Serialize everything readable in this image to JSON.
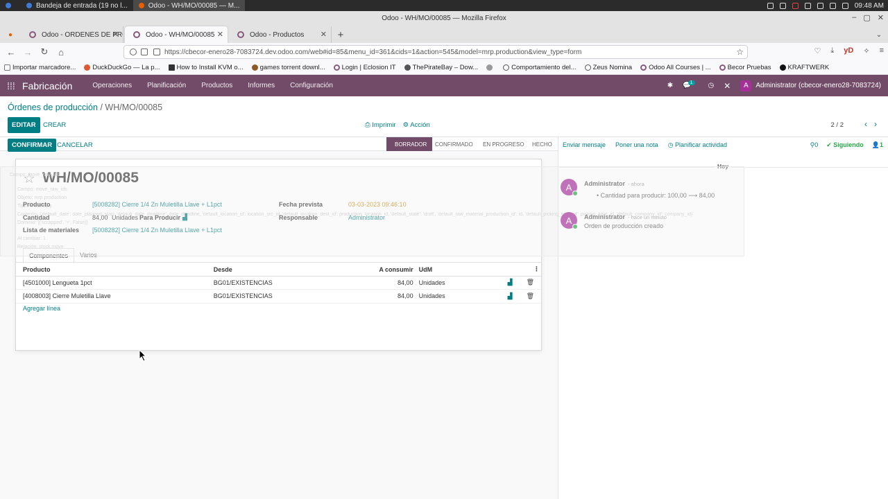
{
  "os": {
    "tasks": [
      "Bandeja de entrada (19 no l...",
      "Odoo - WH/MO/00085 — M..."
    ],
    "clock": "09:48 AM"
  },
  "window": {
    "title": "Odoo - WH/MO/00085 — Mozilla Firefox",
    "tabs": [
      "Odoo - ORDENES DE PRODUCC",
      "Odoo - WH/MO/00085",
      "Odoo - Productos"
    ],
    "url": "https://cbecor-enero28-7083724.dev.odoo.com/web#id=85&menu_id=361&cids=1&action=545&model=mrp.production&view_type=form",
    "bookmarks": [
      "Importar marcadore...",
      "DuckDuckGo — La p...",
      "How to Install KVM o...",
      "games torrent downl...",
      "Login | Eclosion IT",
      "ThePirateBay – Dow...",
      "Comportamiento del...",
      "Zeus Nomina",
      "Odoo All Courses | ...",
      "Becor Pruebas",
      "KRAFTWERK"
    ]
  },
  "odoo_nav": {
    "app": "Fabricación",
    "menus": [
      "Operaciones",
      "Planificación",
      "Productos",
      "Informes",
      "Configuración"
    ],
    "messages_count": "1",
    "user": "Administrator (cbecor-enero28-7083724)",
    "user_initial": "A"
  },
  "control": {
    "breadcrumb_parent": "Órdenes de producción",
    "breadcrumb_sep": "/",
    "breadcrumb_current": "WH/MO/00085",
    "edit": "EDITAR",
    "create": "CREAR",
    "print": "Imprimir",
    "action": "Acción",
    "pager": "2 / 2"
  },
  "status": {
    "confirm": "CONFIRMAR",
    "cancel": "CANCELAR",
    "stages": [
      "BORRADOR",
      "CONFIRMADO",
      "EN PROGRESO",
      "HECHO"
    ],
    "current": "BORRADOR"
  },
  "form": {
    "title": "WH/MO/00085",
    "product_label": "Producto",
    "product_value": "[5008282] Cierre 1/4 Zn Muletilla Llave + L1pct",
    "qty_label": "Cantidad",
    "qty_value": "84,00",
    "qty_uom": "Unidades",
    "qty_to_produce": "Para Producir",
    "bom_label": "Lista de materiales",
    "bom_value": "[5008282] Cierre 1/4 Zn Muletilla Llave + L1pct",
    "date_label": "Fecha prevista",
    "date_value": "03-03-2023 09:46:10",
    "resp_label": "Responsable",
    "resp_value": "Administrator",
    "ghost_lines": [
      "Campo: move_raw_ids",
      "Objeto: mrp.production",
      "Tipo: one2many",
      "Contexto: {'default_date': date_planned_start, 'default_date_deadline': date_deadline, 'default_location_id': location_src_id, 'default_location_dest_id': production_location_id, 'default_state': 'draft', 'default_raw_material_production_id': id, 'default_picking_type_id': picking_type_id, 'default_company_id': company_id}",
      "Dominio: [('scrapped', '=', False)]",
      "Al cambiar: 1",
      "Relación: stock.move"
    ],
    "tabs": [
      "Componentes",
      "Varios"
    ]
  },
  "components": {
    "headers": [
      "Producto",
      "Desde",
      "A consumir",
      "UdM"
    ],
    "rows": [
      {
        "product": "[4501000] Lengueta 1pct",
        "from": "BG01/EXISTENCIAS",
        "qty": "84,00",
        "uom": "Unidades"
      },
      {
        "product": "[4008003] Cierre Muletilla Llave",
        "from": "BG01/EXISTENCIAS",
        "qty": "84,00",
        "uom": "Unidades"
      }
    ],
    "add_line": "Agregar línea"
  },
  "chatter": {
    "send_message": "Enviar mensaje",
    "log_note": "Poner una nota",
    "schedule": "Planificar actividad",
    "attachments": "0",
    "following": "Siguiendo",
    "followers": "1",
    "today": "Hoy",
    "messages": [
      {
        "author": "Administrator",
        "time": "- ahora",
        "body": "Cantidad para producir: 100,00 ⟶ 84,00"
      },
      {
        "author": "Administrator",
        "time": "- hace un minuto",
        "body": "Orden de producción creado"
      }
    ]
  },
  "colors": {
    "brand": "#714b67",
    "accent": "#017e84",
    "avatar": "#a72f9a"
  }
}
